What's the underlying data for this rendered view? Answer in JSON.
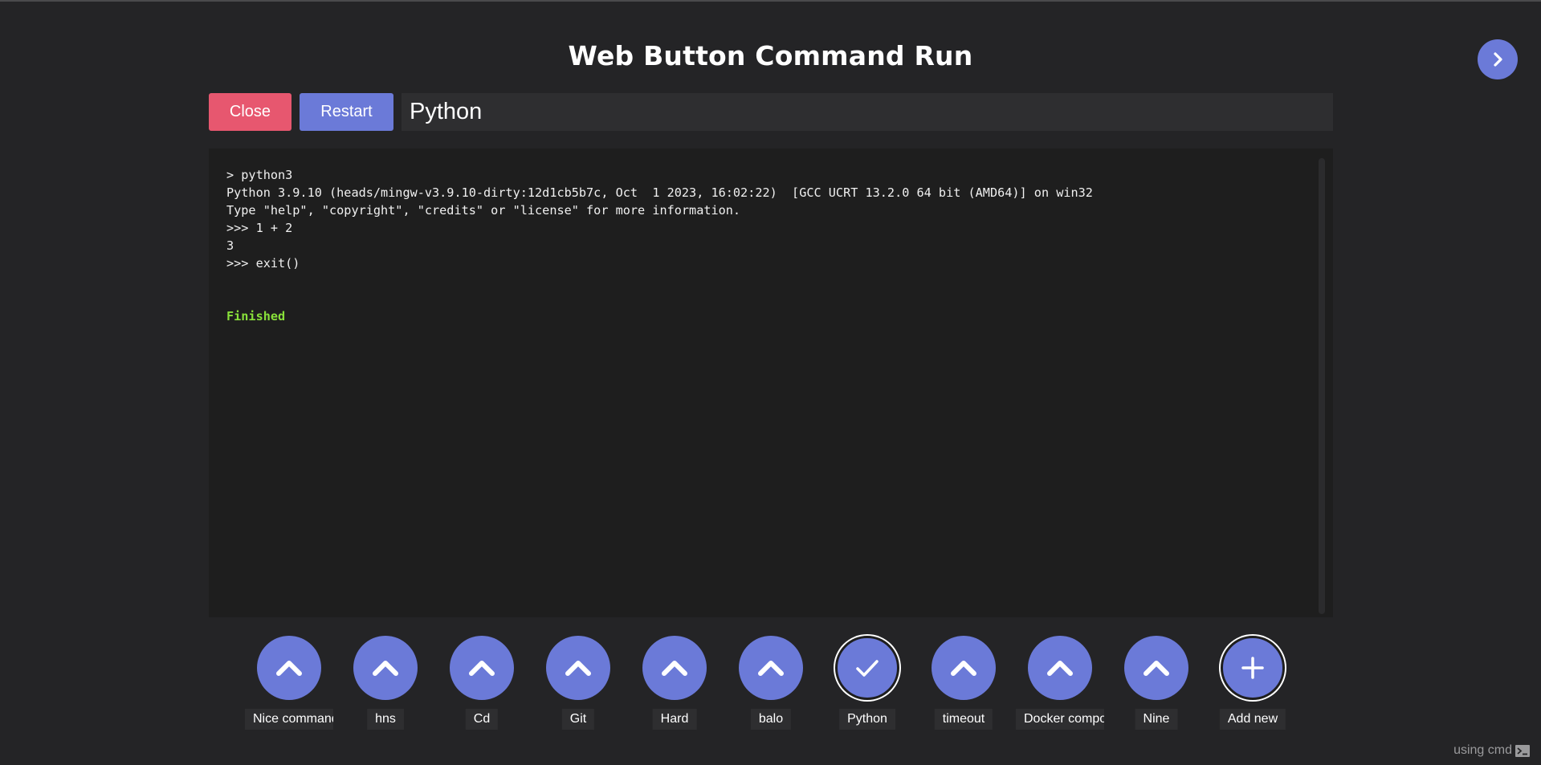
{
  "app": {
    "title": "Web Button Command Run"
  },
  "toolbar": {
    "close_label": "Close",
    "restart_label": "Restart",
    "command_name_value": "Python"
  },
  "terminal": {
    "lines": [
      "> python3",
      "Python 3.9.10 (heads/mingw-v3.9.10-dirty:12d1cb5b7c, Oct  1 2023, 16:02:22)  [GCC UCRT 13.2.0 64 bit (AMD64)] on win32",
      "Type \"help\", \"copyright\", \"credits\" or \"license\" for more information.",
      ">>> 1 + 2",
      "3",
      ">>> exit()",
      "",
      ""
    ],
    "status": "Finished"
  },
  "commands": [
    {
      "label": "Nice command",
      "icon": "chevron-up-icon",
      "selected": false
    },
    {
      "label": "hns",
      "icon": "chevron-up-icon",
      "selected": false
    },
    {
      "label": "Cd",
      "icon": "chevron-up-icon",
      "selected": false
    },
    {
      "label": "Git",
      "icon": "chevron-up-icon",
      "selected": false
    },
    {
      "label": "Hard",
      "icon": "chevron-up-icon",
      "selected": false
    },
    {
      "label": "balo",
      "icon": "chevron-up-icon",
      "selected": false
    },
    {
      "label": "Python",
      "icon": "check-icon",
      "selected": true
    },
    {
      "label": "timeout",
      "icon": "chevron-up-icon",
      "selected": false
    },
    {
      "label": "Docker compose",
      "icon": "chevron-up-icon",
      "selected": false
    },
    {
      "label": "Nine",
      "icon": "chevron-up-icon",
      "selected": false
    },
    {
      "label": "Add new",
      "icon": "plus-icon",
      "selected": true
    }
  ],
  "footer": {
    "using_text": "using cmd"
  },
  "colors": {
    "background": "#242426",
    "accent": "#6b7ad8",
    "danger": "#e7576f",
    "finished": "#88e03a"
  }
}
